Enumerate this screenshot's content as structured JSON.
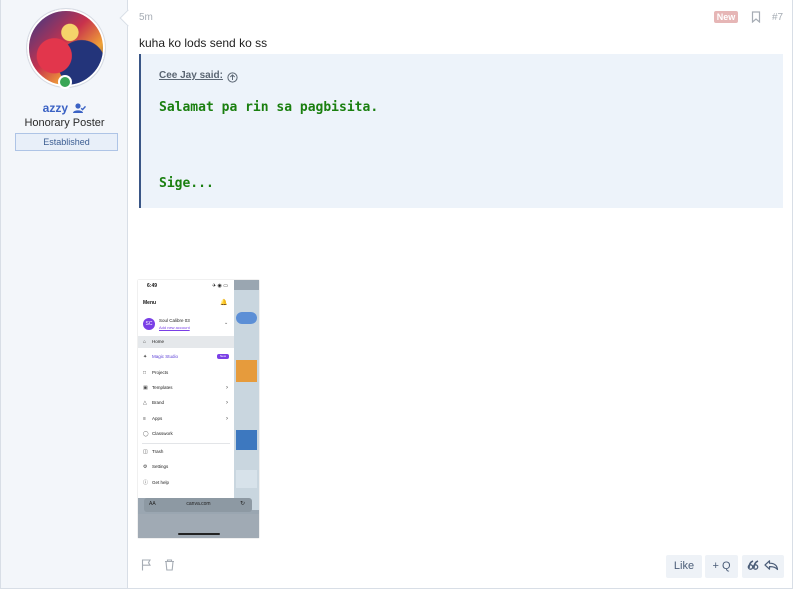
{
  "user": {
    "name": "azzy",
    "title": "Honorary Poster",
    "banner": "Established",
    "online": true
  },
  "post": {
    "time": "5m",
    "new_label": "New",
    "number": "#7",
    "message": "kuha ko lods send ko ss",
    "quote": {
      "author": "Cee Jay said:",
      "line1": "Salamat pa rin sa pagbisita.",
      "line2": "Sige..."
    }
  },
  "screenshot": {
    "status_time": "6:49",
    "status_right": "✈ ◉ ▭",
    "menu_title": "Menu",
    "avatar_initials": "SC",
    "account_name": "Soul Calibre 03",
    "account_sub": "Add new account",
    "items": [
      {
        "label": "Home",
        "icon": "home-icon"
      },
      {
        "label": "Magic Studio",
        "icon": "magic-icon"
      },
      {
        "label": "Projects",
        "icon": "folder-icon"
      },
      {
        "label": "Templates",
        "icon": "templates-icon"
      },
      {
        "label": "Brand",
        "icon": "brand-icon"
      },
      {
        "label": "Apps",
        "icon": "apps-icon"
      },
      {
        "label": "Classwork",
        "icon": "classwork-icon"
      },
      {
        "label": "Trash",
        "icon": "trash-icon"
      },
      {
        "label": "Settings",
        "icon": "settings-icon"
      },
      {
        "label": "Get help",
        "icon": "help-icon"
      }
    ],
    "new_tag": "New",
    "url_aa": "AA",
    "url": "canva.com"
  },
  "actions": {
    "like": "Like",
    "quote": "+ Q",
    "reply_icon": "quote-reply-icon"
  },
  "colors": {
    "username": "#3b62c4",
    "quote_text": "#1a7f0f",
    "quote_bg": "#edf3fa",
    "sidebar_bg": "#f3f6fa"
  }
}
